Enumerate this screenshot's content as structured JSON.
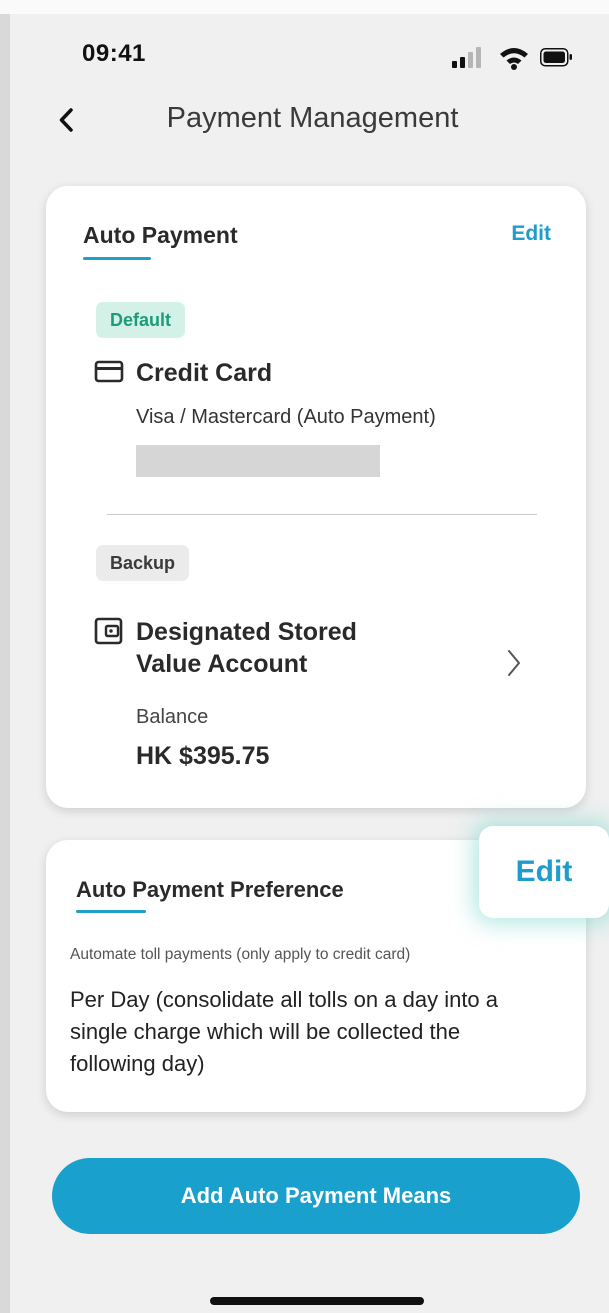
{
  "status_bar": {
    "time": "09:41"
  },
  "nav": {
    "title": "Payment Management"
  },
  "auto_payment": {
    "title": "Auto Payment",
    "edit_label": "Edit",
    "default_tag": "Default",
    "default_method": {
      "name": "Credit Card",
      "subtitle": "Visa / Mastercard (Auto Payment)"
    },
    "backup_tag": "Backup",
    "backup_method": {
      "name_line1": "Designated Stored",
      "name_line2": "Value Account",
      "balance_label": "Balance",
      "balance_value": "HK $395.75"
    }
  },
  "preference": {
    "title": "Auto Payment Preference",
    "edit_label": "Edit",
    "description": "Automate toll payments (only apply to credit card)",
    "value": "Per Day (consolidate all tolls on a day into a single charge which will be collected the following day)"
  },
  "actions": {
    "add_label": "Add Auto Payment Means"
  },
  "colors": {
    "accent": "#1aa0cc",
    "default_tag_bg": "#d4f1e8",
    "default_tag_text": "#1c9c7a",
    "highlight_glow": "#78d7cd"
  }
}
